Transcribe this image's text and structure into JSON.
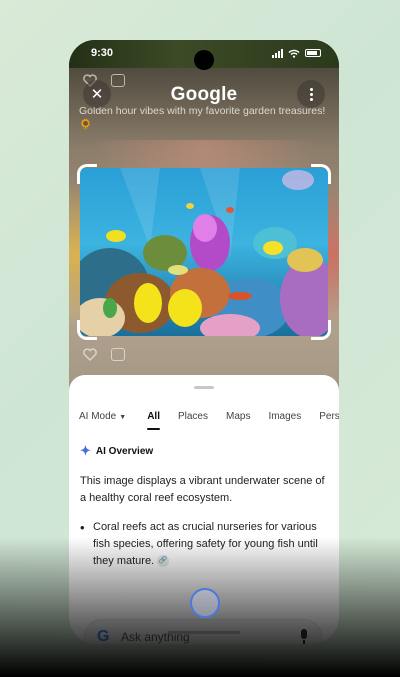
{
  "status_bar": {
    "time": "9:30"
  },
  "header": {
    "title": "Google"
  },
  "background_post": {
    "caption": "Golden hour vibes with my favorite garden treasures! 🌻"
  },
  "tabs": [
    {
      "label": "AI Mode"
    },
    {
      "label": "All",
      "active": true
    },
    {
      "label": "Places"
    },
    {
      "label": "Maps"
    },
    {
      "label": "Images"
    },
    {
      "label": "Pers"
    }
  ],
  "ai_overview": {
    "heading": "AI Overview",
    "summary": "This image displays a vibrant underwater scene of a healthy coral reef ecosystem.",
    "bullet": "Coral reefs act as crucial nurseries for various fish species, offering safety for young fish until they mature."
  },
  "search": {
    "placeholder": "Ask anything",
    "logo_letter": "G"
  },
  "icons": {
    "close": "close-icon",
    "menu": "more-vert-icon",
    "sparkle": "sparkle-icon",
    "mic": "mic-icon",
    "link": "link-icon"
  },
  "colors": {
    "accent": "#4a6ee0",
    "google_blue": "#4285f4"
  }
}
